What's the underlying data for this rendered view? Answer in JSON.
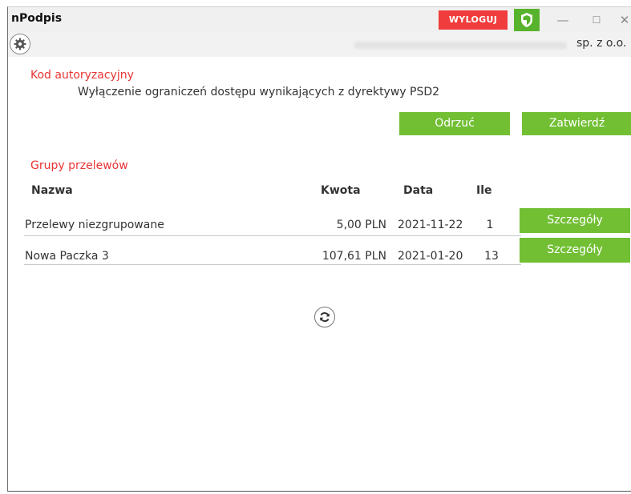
{
  "titlebar": {
    "app_title": "nPodpis",
    "logout_label": "WYLOGUJ",
    "minimize": "—",
    "maximize": "☐",
    "close": "✕"
  },
  "toolbar": {
    "company_suffix": "sp. z o.o."
  },
  "auth": {
    "heading": "Kod autoryzacyjny",
    "description": "Wyłączenie ograniczeń dostępu wynikających z dyrektywy PSD2",
    "reject_label": "Odrzuć",
    "confirm_label": "Zatwierdź"
  },
  "groups": {
    "heading": "Grupy przelewów",
    "columns": {
      "name": "Nazwa",
      "amount": "Kwota",
      "date": "Data",
      "count": "Ile"
    },
    "rows": [
      {
        "name": "Przelewy niezgrupowane",
        "amount": "5,00 PLN",
        "date": "2021-11-22",
        "count": "1",
        "details_label": "Szczegóły"
      },
      {
        "name": "Nowa Paczka 3",
        "amount": "107,61 PLN",
        "date": "2021-01-20",
        "count": "13",
        "details_label": "Szczegóły"
      }
    ]
  },
  "colors": {
    "accent_green": "#72bf34",
    "logout_red": "#f03c3c",
    "heading_red": "#e83434"
  },
  "icons": {
    "shield": "shield-icon",
    "settings": "gear-icon",
    "refresh": "refresh-icon"
  }
}
